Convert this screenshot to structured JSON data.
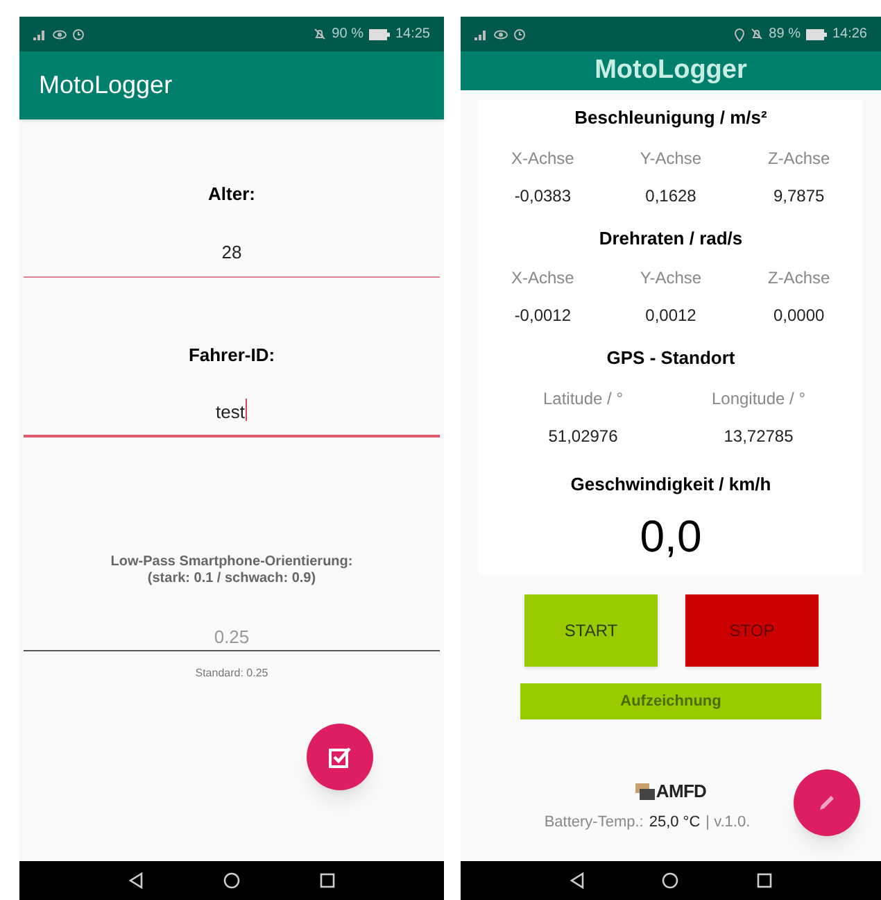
{
  "left_screen": {
    "status_bar": {
      "battery": "90 %",
      "time": "14:25",
      "location": false
    },
    "title": "MotoLogger",
    "fields": [
      {
        "label": "Alter:",
        "value": "28",
        "focused": false
      },
      {
        "label": "Fahrer-ID:",
        "value": "test",
        "focused": true
      }
    ],
    "low_pass": {
      "label": "Low-Pass Smartphone-Orientierung:\n(stark: 0.1  / schwach: 0.9)",
      "placeholder": "0.25",
      "helper": "Standard: 0.25"
    }
  },
  "right_screen": {
    "status_bar": {
      "battery": "89 %",
      "time": "14:26",
      "location": true
    },
    "title": "MotoLogger",
    "sections": [
      {
        "title": "Beschleunigung / m/s²",
        "columns": [
          {
            "label": "X-Achse",
            "value": "-0,0383"
          },
          {
            "label": "Y-Achse",
            "value": "0,1628"
          },
          {
            "label": "Z-Achse",
            "value": "9,7875"
          }
        ]
      },
      {
        "title": "Drehraten / rad/s",
        "columns": [
          {
            "label": "X-Achse",
            "value": "-0,0012"
          },
          {
            "label": "Y-Achse",
            "value": "0,0012"
          },
          {
            "label": "Z-Achse",
            "value": "0,0000"
          }
        ]
      },
      {
        "title": "GPS - Standort",
        "columns": [
          {
            "label": "Latitude / °",
            "value": "51,02976"
          },
          {
            "label": "Longitude / °",
            "value": "13,72785"
          }
        ]
      }
    ],
    "speed": {
      "title": "Geschwindigkeit / km/h",
      "value": "0,0"
    },
    "buttons": [
      {
        "label": "START",
        "kind": "start"
      },
      {
        "label": "STOP",
        "kind": "stop"
      }
    ],
    "record_bar": "Aufzeichnung",
    "logo": "AMFD",
    "footer": {
      "label": "Battery-Temp.:",
      "value": "25,0 °C",
      "version": "| v.1.0."
    }
  }
}
